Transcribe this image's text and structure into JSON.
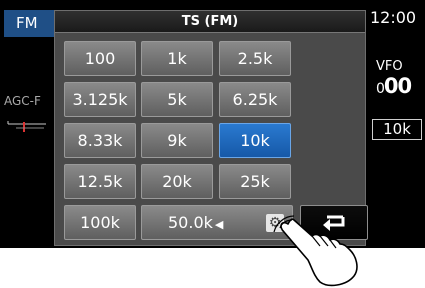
{
  "background": {
    "mode_tab": "FM",
    "agc_label": "AGC-F",
    "clock": "12:00",
    "vfo_label": "VFO",
    "vfo_digits_small": "0",
    "vfo_digits_big": "00",
    "ts_box": "10k"
  },
  "dialog": {
    "title": "TS (FM)",
    "buttons": [
      "100",
      "1k",
      "2.5k",
      "3.125k",
      "5k",
      "6.25k",
      "8.33k",
      "9k",
      "10k",
      "12.5k",
      "20k",
      "25k",
      "100k"
    ],
    "selected": "10k",
    "custom_value": "50.0k",
    "back_icon": "return-arrow-icon",
    "settings_icon": "gear-icon"
  },
  "colors": {
    "accent": "#1659a8",
    "button": "#6f6f6f",
    "background": "#000000"
  }
}
